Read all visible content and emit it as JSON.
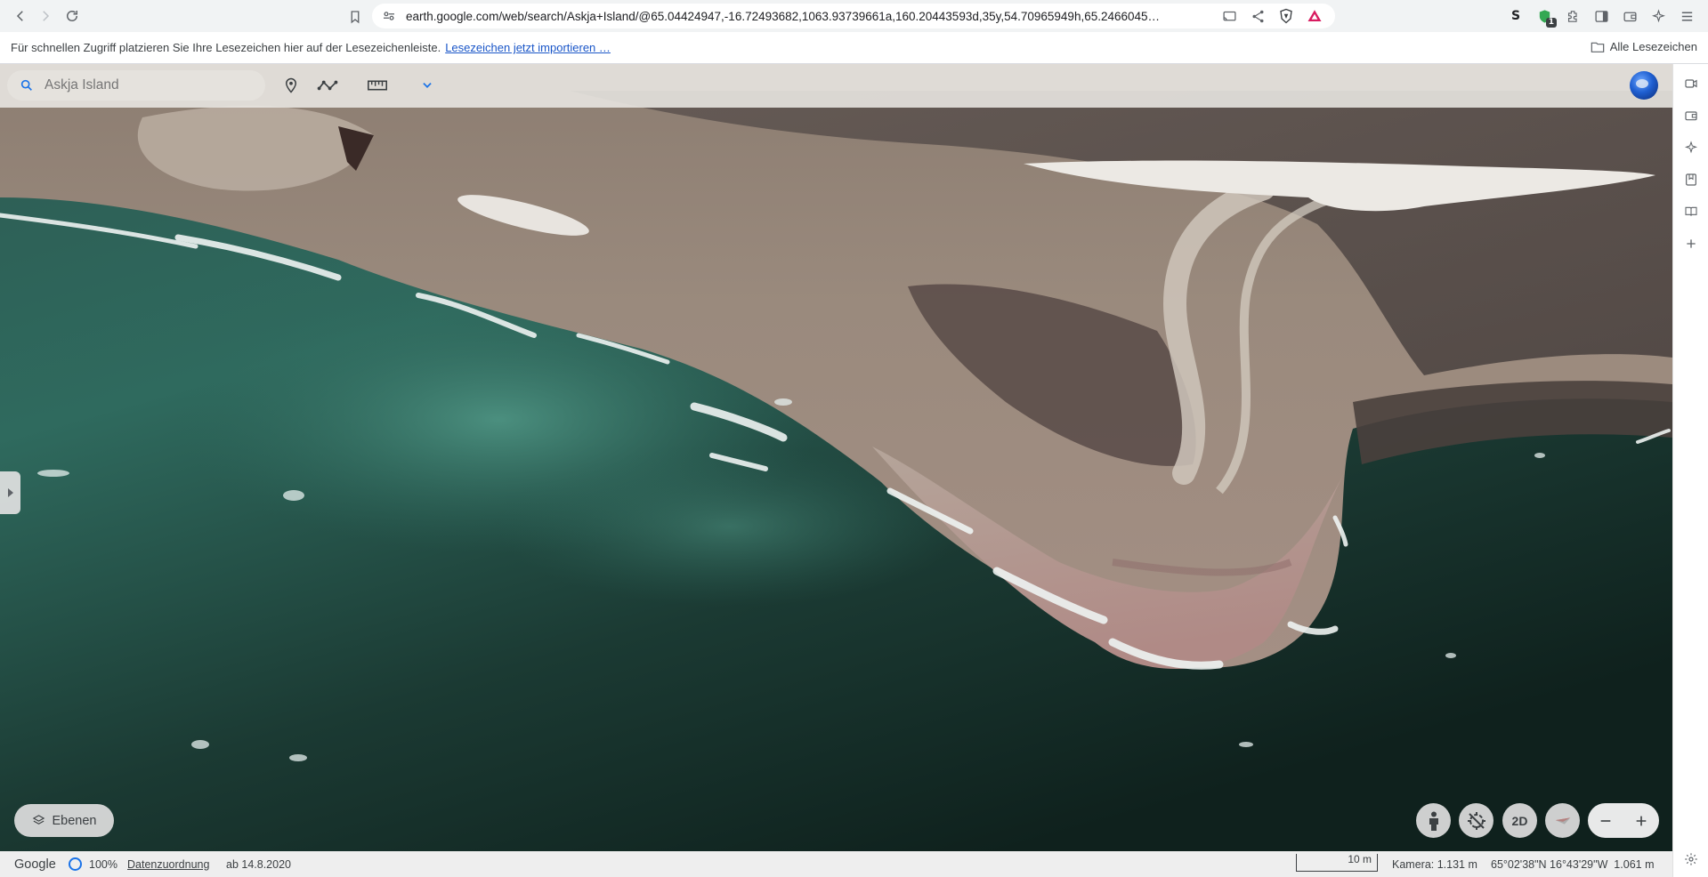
{
  "browser": {
    "url": "earth.google.com/web/search/Askja+Island/@65.04424947,-16.72493682,1063.93739661a,160.20443593d,35y,54.70965949h,65.2466045…",
    "extension_badge": "1",
    "bookmarks_bar": {
      "message": "Für schnellen Zugriff platzieren Sie Ihre Lesezeichen hier auf der Lesezeichenleiste.",
      "import_link": "Lesezeichen jetzt importieren …",
      "all_bookmarks": "Alle Lesezeichen"
    }
  },
  "earth": {
    "search_placeholder": "Askja Island",
    "layers_label": "Ebenen",
    "view_mode_label": "2D",
    "status": {
      "brand": "Google",
      "render_percent": "100%",
      "attribution": "Datenzuordnung",
      "imagery_date": "ab 14.8.2020",
      "scale": "10 m",
      "camera": "Kamera: 1.131 m",
      "coords": "65°02'38\"N 16°43'29\"W  1.061 m"
    }
  },
  "colors": {
    "accent": "#1a73e8",
    "link": "#1a56c8"
  }
}
